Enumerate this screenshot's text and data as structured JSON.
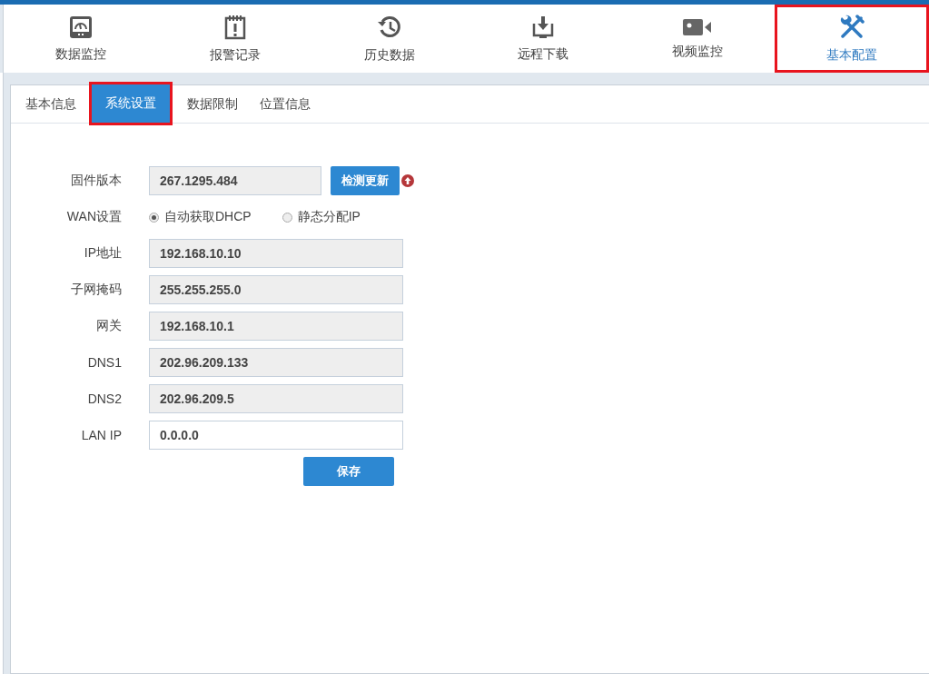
{
  "nav": [
    {
      "label": "数据监控",
      "selected": false
    },
    {
      "label": "报警记录",
      "selected": false
    },
    {
      "label": "历史数据",
      "selected": false
    },
    {
      "label": "远程下载",
      "selected": false
    },
    {
      "label": "视频监控",
      "selected": false
    },
    {
      "label": "基本配置",
      "selected": true
    }
  ],
  "tabs": [
    {
      "label": "基本信息",
      "selected": false
    },
    {
      "label": "系统设置",
      "selected": true
    },
    {
      "label": "数据限制",
      "selected": false
    },
    {
      "label": "位置信息",
      "selected": false
    }
  ],
  "form": {
    "firmware": {
      "label": "固件版本",
      "value": "267.1295.484",
      "disabled": true,
      "button": "检测更新"
    },
    "wan": {
      "label": "WAN设置",
      "options": [
        {
          "label": "自动获取DHCP",
          "selected": true
        },
        {
          "label": "静态分配IP",
          "selected": false
        }
      ]
    },
    "fields": [
      {
        "label": "IP地址",
        "value": "192.168.10.10",
        "disabled": true
      },
      {
        "label": "子网掩码",
        "value": "255.255.255.0",
        "disabled": true
      },
      {
        "label": "网关",
        "value": "192.168.10.1",
        "disabled": true
      },
      {
        "label": "DNS1",
        "value": "202.96.209.133",
        "disabled": true
      },
      {
        "label": "DNS2",
        "value": "202.96.209.5",
        "disabled": true
      },
      {
        "label": "LAN IP",
        "value": "0.0.0.0",
        "disabled": false
      }
    ],
    "save_button": "保存"
  }
}
